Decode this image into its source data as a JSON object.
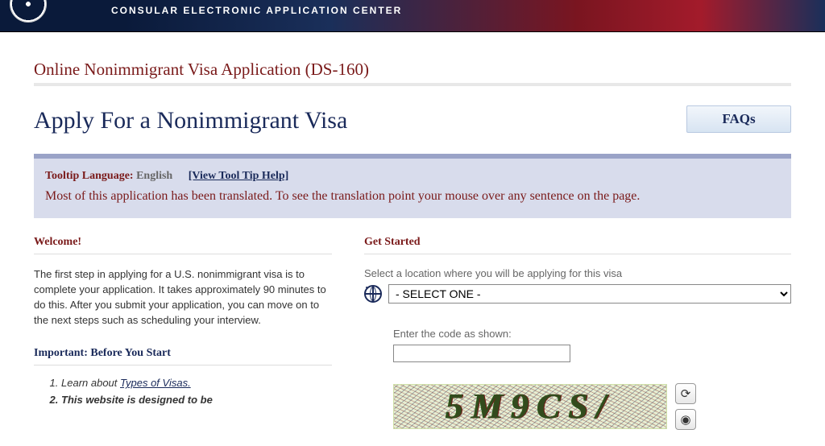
{
  "banner": {
    "org_text": "CONSULAR ELECTRONIC APPLICATION CENTER"
  },
  "app_title": "Online Nonimmigrant Visa Application (DS-160)",
  "page_heading": "Apply For a Nonimmigrant Visa",
  "faq_button": "FAQs",
  "language_bar": {
    "label": "Tooltip Language:",
    "value": "English",
    "help_link": "[View Tool Tip Help]",
    "notice": "Most of this application has been translated. To see the translation point your mouse over any sentence on the page."
  },
  "left": {
    "welcome_heading": "Welcome!",
    "welcome_text": "The first step in applying for a U.S. nonimmigrant visa is to complete your application. It takes approximately 90 minutes to do this. After you submit your application, you can move on to the next steps such as scheduling your interview.",
    "important_heading": "Important: Before You Start",
    "point1_prefix": "Learn about ",
    "point1_link": "Types of Visas.",
    "point2": "This website is designed to be"
  },
  "right": {
    "get_started_heading": "Get Started",
    "location_label": "Select a location where you will be applying for this visa",
    "location_selected": "- SELECT ONE -",
    "captcha_label": "Enter the code as shown:",
    "captcha_display": "5M9CS/"
  }
}
